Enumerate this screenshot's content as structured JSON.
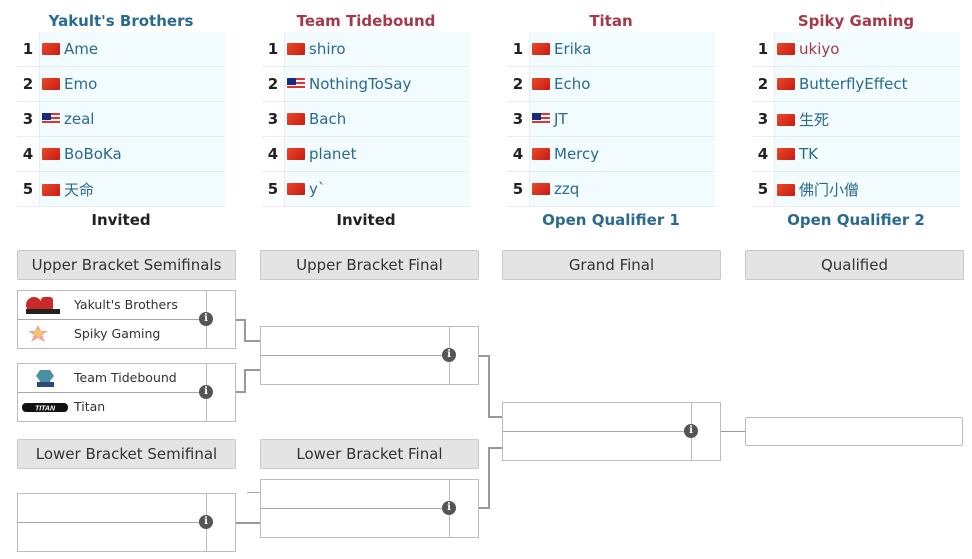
{
  "teams": [
    {
      "name": "Yakult's Brothers",
      "title_color": "#2b6a8f",
      "qualification": "Invited",
      "qual_color": "#222222",
      "players": [
        {
          "pos": "1",
          "flag": "cn",
          "name": "Ame"
        },
        {
          "pos": "2",
          "flag": "cn",
          "name": "Emo"
        },
        {
          "pos": "3",
          "flag": "my",
          "name": "zeal"
        },
        {
          "pos": "4",
          "flag": "cn",
          "name": "BoBoKa"
        },
        {
          "pos": "5",
          "flag": "cn",
          "name": "天命"
        }
      ]
    },
    {
      "name": "Team Tidebound",
      "title_color": "#a33a4a",
      "qualification": "Invited",
      "qual_color": "#222222",
      "players": [
        {
          "pos": "1",
          "flag": "cn",
          "name": "shiro"
        },
        {
          "pos": "2",
          "flag": "my",
          "name": "NothingToSay"
        },
        {
          "pos": "3",
          "flag": "cn",
          "name": "Bach"
        },
        {
          "pos": "4",
          "flag": "cn",
          "name": "planet"
        },
        {
          "pos": "5",
          "flag": "cn",
          "name": "y`"
        }
      ]
    },
    {
      "name": "Titan",
      "title_color": "#a33a4a",
      "qualification": "Open Qualifier 1",
      "qual_color": "#2b6a8f",
      "players": [
        {
          "pos": "1",
          "flag": "cn",
          "name": "Erika"
        },
        {
          "pos": "2",
          "flag": "cn",
          "name": "Echo"
        },
        {
          "pos": "3",
          "flag": "my",
          "name": "JT"
        },
        {
          "pos": "4",
          "flag": "cn",
          "name": "Mercy"
        },
        {
          "pos": "5",
          "flag": "cn",
          "name": "zzq"
        }
      ]
    },
    {
      "name": "Spiky Gaming",
      "title_color": "#a33a4a",
      "qualification": "Open Qualifier 2",
      "qual_color": "#2b6a8f",
      "players": [
        {
          "pos": "1",
          "flag": "cn",
          "name": "ukiyo",
          "red": true
        },
        {
          "pos": "2",
          "flag": "cn",
          "name": "ButterflyEffect"
        },
        {
          "pos": "3",
          "flag": "cn",
          "name": "生死"
        },
        {
          "pos": "4",
          "flag": "cn",
          "name": "TK"
        },
        {
          "pos": "5",
          "flag": "cn",
          "name": "佛门小僧"
        }
      ]
    }
  ],
  "rounds": {
    "ub_semis": "Upper Bracket Semifinals",
    "ub_final": "Upper Bracket Final",
    "grand_final": "Grand Final",
    "qualified": "Qualified",
    "lb_semi": "Lower Bracket Semifinal",
    "lb_final": "Lower Bracket Final"
  },
  "matches": {
    "ubs1": {
      "team1": "Yakult's Brothers",
      "team1_logo": "yakults-brothers-logo",
      "team2": "Spiky Gaming",
      "team2_logo": "spiky-gaming-logo"
    },
    "ubs2": {
      "team1": "Team Tidebound",
      "team1_logo": "team-tidebound-logo",
      "team2": "Titan",
      "team2_logo": "titan-logo"
    },
    "ubf": {
      "team1": "",
      "team2": ""
    },
    "gf": {
      "team1": "",
      "team2": ""
    },
    "lbs": {
      "team1": "",
      "team2": ""
    },
    "lbf": {
      "team1": "",
      "team2": ""
    }
  },
  "info_icon": "i"
}
